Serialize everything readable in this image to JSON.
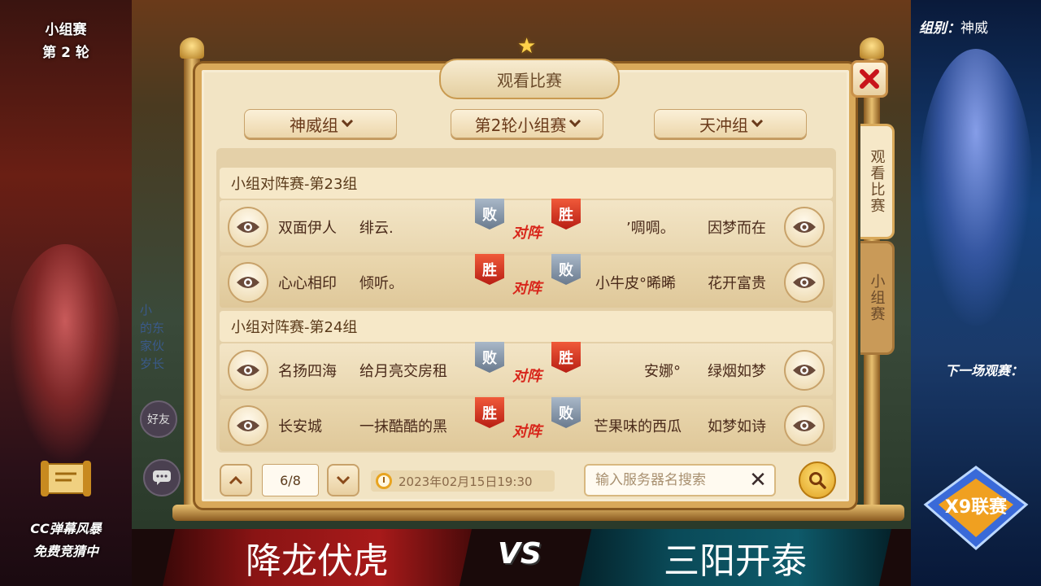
{
  "overlay_left": {
    "stage": "小组赛",
    "round": "第 2 轮",
    "promo_line1": "CC弹幕风暴",
    "promo_line2": "免费竞猜中"
  },
  "overlay_right": {
    "group_prefix": "组别：",
    "group_value": "神威",
    "next_match": "下一场观赛："
  },
  "background": {
    "chat_lines": [
      "小",
      "的东",
      "家伙",
      "岁长"
    ],
    "friends_label": "好友"
  },
  "dialog": {
    "title": "观看比赛",
    "dropdowns": [
      "神威组",
      "第2轮小组赛",
      "天冲组"
    ],
    "side_tabs": [
      "观看比赛",
      "小组赛"
    ],
    "vs_label": "对阵",
    "win_label": "胜",
    "lose_label": "败",
    "groups": [
      {
        "title": "小组对阵赛-第23组",
        "matches": [
          {
            "left_p1": "双面伊人",
            "left_p2": "绯云.",
            "left_result": "败",
            "right_result": "胜",
            "right_p1": "’啁啁。",
            "right_p2": "因梦而在"
          },
          {
            "left_p1": "心心相印",
            "left_p2": "倾听。",
            "left_result": "胜",
            "right_result": "败",
            "right_p1": "小牛皮°晞晞",
            "right_p2": "花开富贵"
          }
        ]
      },
      {
        "title": "小组对阵赛-第24组",
        "matches": [
          {
            "left_p1": "名扬四海",
            "left_p2": "给月亮交房租",
            "left_result": "败",
            "right_result": "胜",
            "right_p1": "安娜°",
            "right_p2": "绿烟如梦"
          },
          {
            "left_p1": "长安城",
            "left_p2": "一抹酷酷的黑",
            "left_result": "胜",
            "right_result": "败",
            "right_p1": "芒果味的西瓜",
            "right_p2": "如梦如诗"
          }
        ]
      }
    ],
    "page_indicator": "6/8",
    "datetime": "2023年02月15日19:30",
    "search_placeholder": "输入服务器名搜索"
  },
  "vs_banner": {
    "team_left": "降龙伏虎",
    "vs": "VS",
    "team_right": "三阳开泰"
  },
  "logo_text": "X9联赛",
  "colors": {
    "win": "#d8281a",
    "lose": "#7a8a9e",
    "panel": "#f2e4c4",
    "gold": "#d9a95a"
  }
}
